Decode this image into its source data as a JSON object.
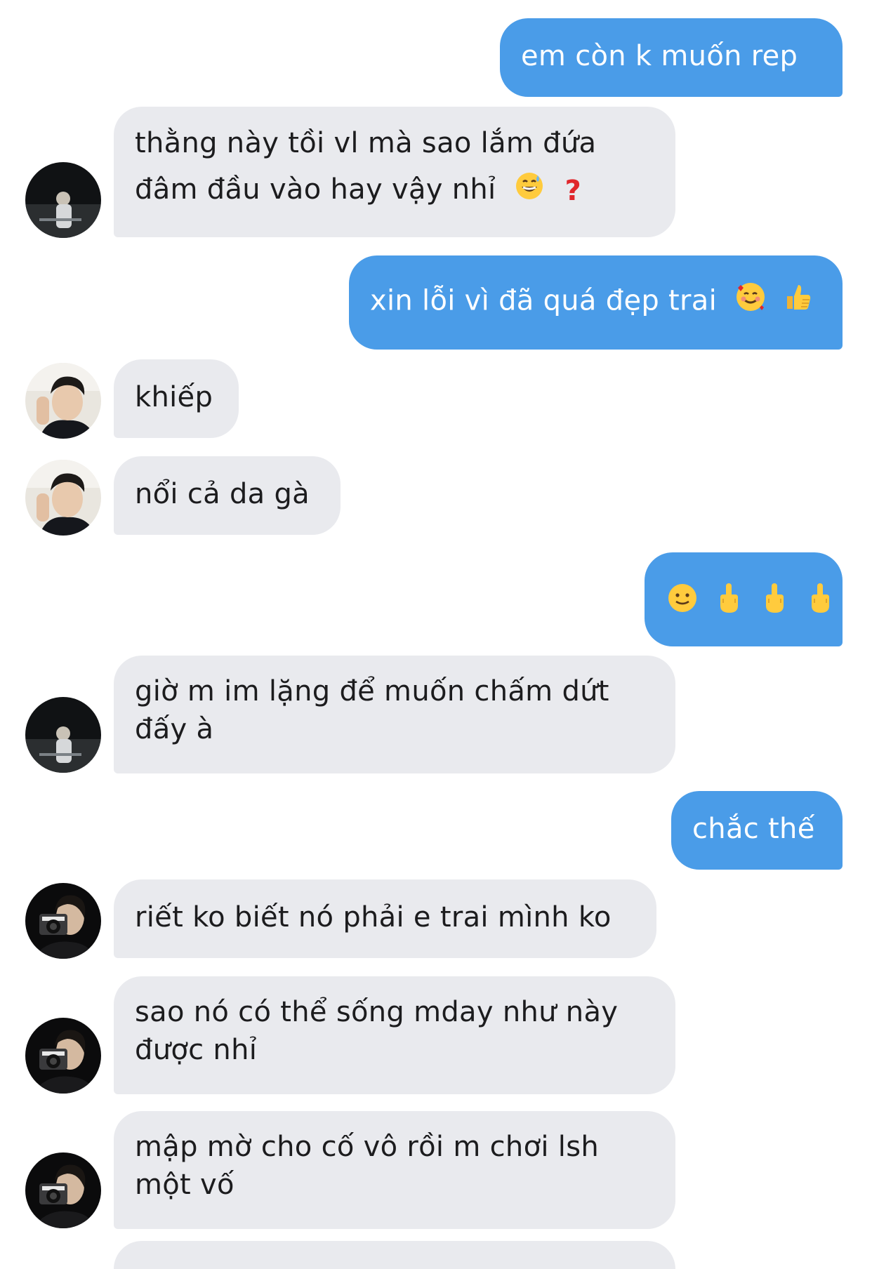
{
  "messages": [
    {
      "side": "out",
      "text": "em còn k muốn rep"
    },
    {
      "side": "in",
      "avatar": "dark-night-avatar",
      "line1": "thằng này tồi vl mà sao lắm đứa",
      "line2": "đâm đầu vào hay vậy nhỉ",
      "emojis": [
        "grinning-sweat-emoji",
        "red-question-mark"
      ]
    },
    {
      "side": "out",
      "text": "xin lỗi vì đã quá đẹp trai",
      "emojis": [
        "smiling-hearts-emoji",
        "thumbs-up-emoji"
      ]
    },
    {
      "side": "in",
      "avatar": "selfie-avatar",
      "text": "khiếp"
    },
    {
      "side": "in",
      "avatar": "selfie-avatar",
      "text": "nổi cả da gà"
    },
    {
      "side": "out",
      "emojis": [
        "slightly-smiling-emoji",
        "middle-finger-emoji",
        "middle-finger-emoji",
        "middle-finger-emoji"
      ]
    },
    {
      "side": "in",
      "avatar": "dark-night-avatar",
      "line1": "giờ m im lặng để muốn chấm dứt",
      "line2": "đấy à"
    },
    {
      "side": "out",
      "text": "chắc thế"
    },
    {
      "side": "in",
      "avatar": "camera-avatar",
      "text": "riết ko biết nó phải e trai mình ko"
    },
    {
      "side": "in",
      "avatar": "camera-avatar",
      "line1": "sao nó có thể sống mday như này",
      "line2": "được nhỉ"
    },
    {
      "side": "in",
      "avatar": "camera-avatar",
      "line1": "mập mờ cho cố vô rồi m chơi lsh",
      "line2": "một vố"
    }
  ],
  "colors": {
    "outgoing": "#4a9ce8",
    "incoming": "#e9eaee",
    "incoming_text": "#1c1c1e",
    "outgoing_text": "#ffffff"
  }
}
